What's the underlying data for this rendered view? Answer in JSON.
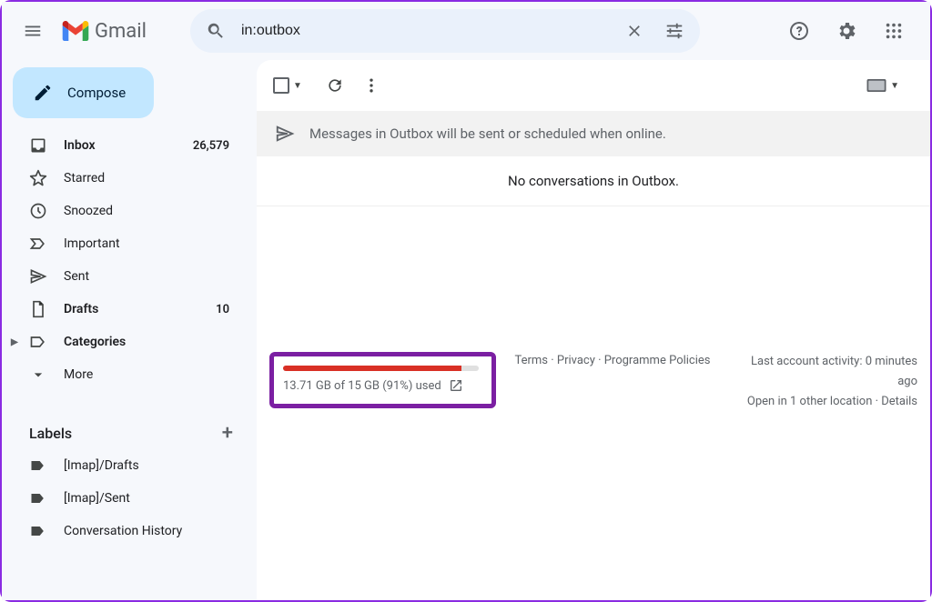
{
  "header": {
    "app_name": "Gmail",
    "search_value": "in:outbox"
  },
  "compose_label": "Compose",
  "nav": [
    {
      "icon": "inbox",
      "label": "Inbox",
      "count": "26,579",
      "bold": true
    },
    {
      "icon": "star",
      "label": "Starred",
      "count": "",
      "bold": false
    },
    {
      "icon": "clock",
      "label": "Snoozed",
      "count": "",
      "bold": false
    },
    {
      "icon": "important",
      "label": "Important",
      "count": "",
      "bold": false
    },
    {
      "icon": "send",
      "label": "Sent",
      "count": "",
      "bold": false
    },
    {
      "icon": "draft",
      "label": "Drafts",
      "count": "10",
      "bold": true
    },
    {
      "icon": "categories",
      "label": "Categories",
      "count": "",
      "bold": true
    },
    {
      "icon": "more",
      "label": "More",
      "count": "",
      "bold": false
    }
  ],
  "labels_header": "Labels",
  "labels": [
    {
      "label": "[Imap]/Drafts"
    },
    {
      "label": "[Imap]/Sent"
    },
    {
      "label": "Conversation History"
    }
  ],
  "banner_text": "Messages in Outbox will be sent or scheduled when online.",
  "empty_text": "No conversations in Outbox.",
  "storage": {
    "percent": 91,
    "text": "13.71 GB of 15 GB (91%) used"
  },
  "footer_links": {
    "terms": "Terms",
    "privacy": "Privacy",
    "programme": "Programme Policies"
  },
  "activity": {
    "line1": "Last account activity: 0 minutes ago",
    "line2_prefix": "Open in 1 other location · ",
    "details": "Details"
  }
}
